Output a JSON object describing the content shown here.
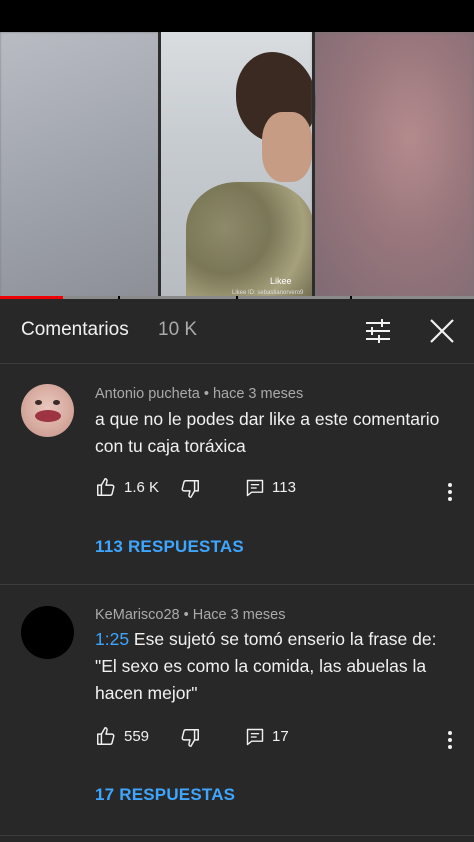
{
  "header": {
    "title": "Comentarios",
    "count": "10 K"
  },
  "video": {
    "watermark": "Likee",
    "watermark_sub": "Likee ID: sebastianorvero9"
  },
  "colors": {
    "panel_bg": "#282828",
    "link_blue": "#3ea6ff",
    "progress_red": "#ff0000",
    "secondary_text": "#aaaaaa"
  },
  "comments": [
    {
      "author": "Antonio pucheta",
      "separator": " • ",
      "time": "hace 3 meses",
      "text": "a que no le podes dar like a este comentario con tu caja toráxica",
      "timestamp": "",
      "likes": "1.6 K",
      "replies_count": "113",
      "replies_link": "113 RESPUESTAS"
    },
    {
      "author": "KeMarisco28",
      "separator": " • ",
      "time": "Hace 3 meses",
      "timestamp": "1:25",
      "text": " Ese sujetó se tomó enserio la frase de: \"El sexo es como la comida, las abuelas la hacen mejor\"",
      "likes": "559",
      "replies_count": "17",
      "replies_link": "17 RESPUESTAS"
    }
  ],
  "icons": [
    "filter-icon",
    "close-icon",
    "like-icon",
    "dislike-icon",
    "reply-icon",
    "more-vert-icon"
  ]
}
